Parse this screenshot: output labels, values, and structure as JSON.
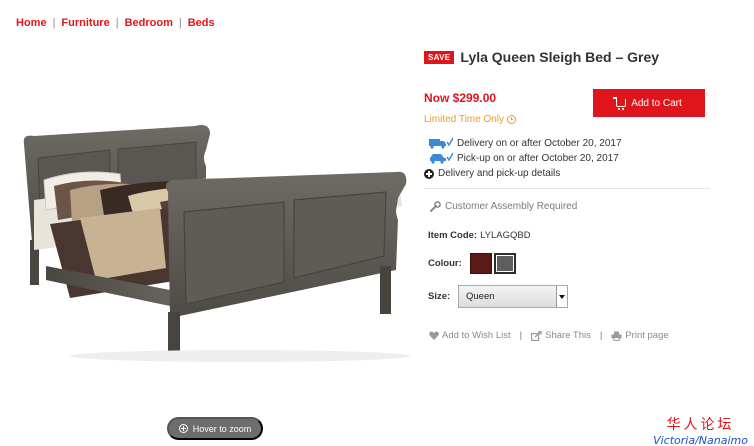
{
  "breadcrumb": {
    "items": [
      "Home",
      "Furniture",
      "Bedroom",
      "Beds"
    ],
    "separator": "|"
  },
  "gallery": {
    "image_alt": "Lyla Queen Sleigh Bed – Grey",
    "zoom_hint": "Hover to zoom"
  },
  "product": {
    "badge": "SAVE",
    "title": "Lyla Queen Sleigh Bed – Grey",
    "price": "Now $299.00",
    "limited": "Limited Time Only",
    "add_to_cart": "Add to Cart",
    "delivery": "Delivery on or after October 20, 2017",
    "pickup": "Pick-up on or after October 20, 2017",
    "details_link": "Delivery and pick-up details",
    "assembly": "Customer Assembly Required",
    "item_code_label": "Item Code:",
    "item_code": "LYLAGQBD",
    "colour_label": "Colour:",
    "colours": [
      "#5a1a17",
      "#5e5e5e"
    ],
    "size_label": "Size:",
    "size_value": "Queen"
  },
  "actions": {
    "wishlist": "Add to Wish List",
    "share": "Share This",
    "print": "Print page",
    "separator": "|"
  },
  "watermark": {
    "cn": "华人论坛",
    "en": "Victoria/Nanaimo"
  },
  "colors": {
    "accent": "#e0141b",
    "limited": "#f39a1b",
    "icon_blue": "#3a8ad8"
  }
}
